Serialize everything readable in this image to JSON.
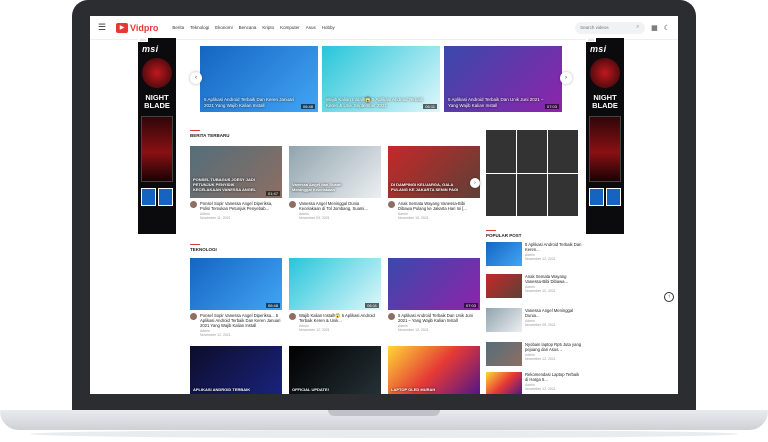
{
  "header": {
    "logo": "Vidpro",
    "nav": [
      "Berita",
      "Teknologi",
      "Ekonomi",
      "Bencana",
      "Kripto",
      "Komputer",
      "Asus",
      "Hobby"
    ],
    "search_placeholder": "Search videos"
  },
  "ads": {
    "tag": "Ads",
    "brand": "msi",
    "title": "NIGHT BLADE"
  },
  "slider": [
    {
      "caption": "5 Aplikasi Android Terbaik Dan Keren Januari 2021 Yang Wajib Kalian Install",
      "duration": "06:48"
    },
    {
      "caption": "Wajib Kalian Install!😱 5 Aplikasi Android Terbaik Keren & Unik September 2021",
      "duration": "06:11"
    },
    {
      "caption": "5 Aplikasi Android Terbaik Dan Unik Juni 2021 – Yang Wajib Kalian Install",
      "duration": "07:03"
    }
  ],
  "berita": {
    "title": "BERITA TERBARU",
    "cards": [
      {
        "thumb_text": "PONSEL TUBAGUS JOESY JADI PETUNJUK PENYIDIK KECELAKAAN VANESSA ANGEL",
        "title": "Ponsel Sopir Vanessa Angel Diperiksa, Polisi Temukan Petunjuk Penyebab...",
        "author": "Admin",
        "date": "November 11, 2021",
        "duration": "01:47"
      },
      {
        "thumb_text": "Vanessa Angel dan Suami Meninggal Kecelakaan",
        "title": "Vanessa Angel Meninggal Dunia Kecelakaan di Tol Jombang, Suami...",
        "author": "Admin",
        "date": "November 09, 2021",
        "duration": ""
      },
      {
        "thumb_text": "DI DAMPINGI KELUARGA, GALA PULANG KE JAKARTA SENIN PAGI",
        "title": "Anak Semata Wayang Vanessa-Bibi Dibawa Pulang ke Jakarta Hari Ini [...",
        "author": "Admin",
        "date": "November 10, 2021",
        "duration": ""
      }
    ]
  },
  "teknologi": {
    "title": "TEKNOLOGI",
    "cards": [
      {
        "title": "Ponsel Sopir Vanessa Angel Diperiksa... 5 Aplikasi Android Terbaik Dan Keren Januari 2021 Yang Wajib Kalian Install",
        "author": "Admin",
        "date": "November 12, 2021",
        "duration": "06:48"
      },
      {
        "title": "Wajib Kalian Install!😱 5 Aplikasi Android Terbaik Keren & Unik...",
        "author": "Admin",
        "date": "November 12, 2021",
        "duration": "06:11"
      },
      {
        "title": "5 Aplikasi Android Terbaik Dan Unik Juni 2021 – Yang Wajib Kalian Install",
        "author": "Admin",
        "date": "November 12, 2021",
        "duration": "07:03"
      }
    ],
    "bottom_texts": [
      "APLIKASI ANDROID TERBAIK",
      "OFFICIAL UPDATE!",
      "LAPTOP OLED MURAH"
    ]
  },
  "popular": {
    "title": "POPULAR POST",
    "items": [
      {
        "title": "5 Aplikasi Android Terbaik Dan Keren...",
        "author": "Admin",
        "date": "November 12, 2021"
      },
      {
        "title": "Anak Semata Wayang Vanessa-Bibi Dibawa...",
        "author": "Admin",
        "date": "November 10, 2021"
      },
      {
        "title": "Vanessa Angel Meninggal Dunia...",
        "author": "Admin",
        "date": "November 09, 2021"
      },
      {
        "title": "Nyobain laptop Rp5 Juta yang pejuang dari Asus...",
        "author": "Admin",
        "date": "November 12, 2021"
      },
      {
        "title": "Rekomendasi Laptop Terbaik di Harga 5...",
        "author": "Admin",
        "date": "November 12, 2021"
      }
    ]
  }
}
